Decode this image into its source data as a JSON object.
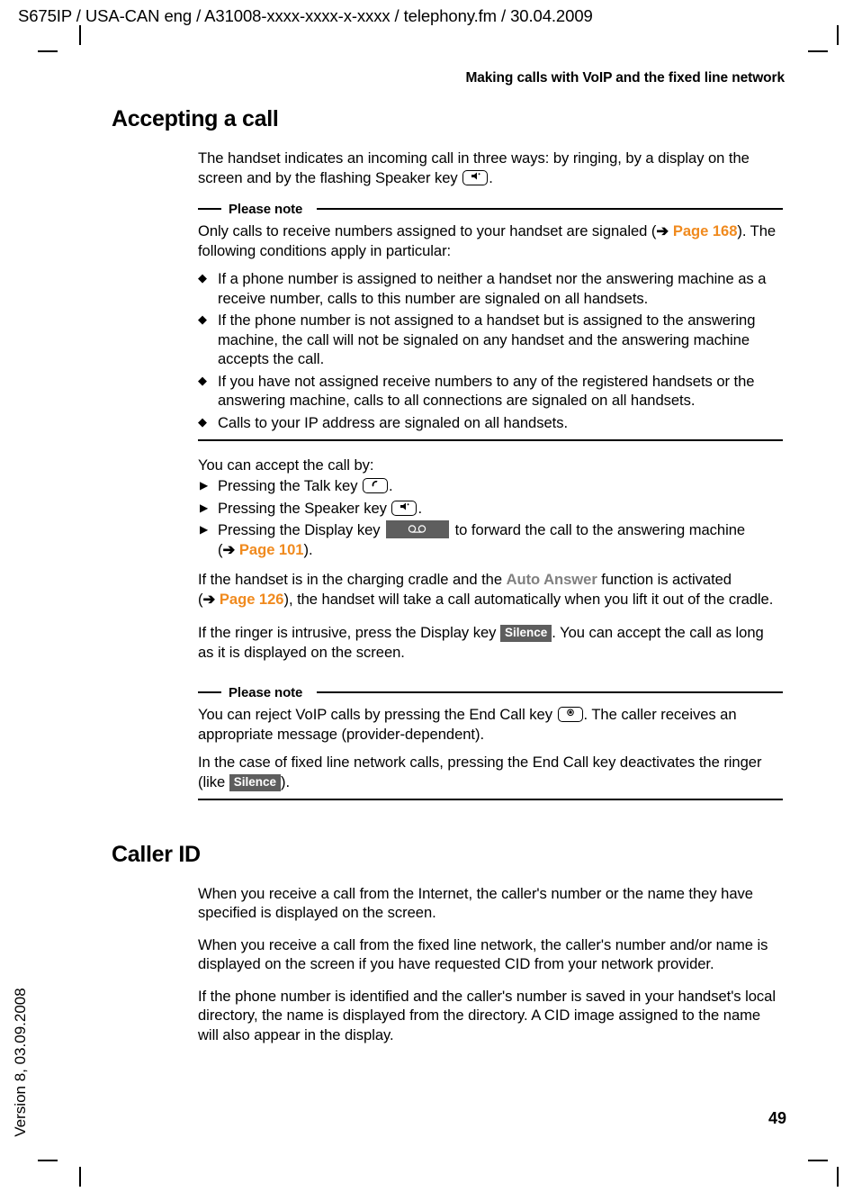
{
  "imposition_line": "S675IP  / USA-CAN eng / A31008-xxxx-xxxx-x-xxxx / telephony.fm / 30.04.2009",
  "version_side": "Version 8, 03.09.2008",
  "running_head": "Making calls with VoIP and the fixed line network",
  "page_number": "49",
  "colors": {
    "xref": "#F08A1E",
    "softkey_bg": "#5E5E5E",
    "uiterm": "#808080"
  },
  "sections": [
    {
      "heading": "Accepting a call",
      "intro": {
        "part1": "The handset indicates an incoming call in three ways: by ringing, by a display on the screen and by the flashing Speaker key ",
        "key_icon": "speaker-key-icon",
        "part2": "."
      },
      "note1": {
        "title": "Please note",
        "lead": {
          "part1": "Only calls to receive numbers assigned to your handset are signaled (",
          "arrow": "➔",
          "link": "Page 168",
          "part2": "). The following conditions apply in particular:"
        },
        "bullets": [
          "If a phone number is assigned to neither a handset nor the answering machine as a receive number, calls to this number are signaled on all handsets.",
          "If the phone number is not assigned to a handset but is assigned to the answering machine, the call will not be signaled on any handset and the answering machine accepts the call.",
          "If you have not assigned receive numbers to any of the registered handsets or the answering machine, calls to all connections are signaled on all handsets.",
          "Calls to your IP address are signaled on all handsets."
        ]
      },
      "accept_lead": "You can accept the call by:",
      "accept_steps": [
        {
          "part1": "Pressing the Talk key ",
          "key_icon": "talk-key-icon",
          "part2": "."
        },
        {
          "part1": "Pressing the Speaker key ",
          "key_icon": "speaker-key-icon",
          "part2": "."
        },
        {
          "part1": "Pressing the Display key ",
          "softkey_icon": "answering-machine-softkey",
          "part2": " to forward the call to the answering machine (",
          "arrow": "➔",
          "link": "Page 101",
          "part3": ")."
        }
      ],
      "auto_answer": {
        "part1": "If the handset is in the charging cradle and the ",
        "term": "Auto Answer",
        "part2": " function is activated (",
        "arrow": "➔",
        "link": "Page 126",
        "part3": "), the handset will take a call automatically when you lift it out of the cradle."
      },
      "silence_para": {
        "part1": "If the ringer is intrusive, press the Display key ",
        "softkey": "Silence",
        "part2": ". You can accept the call as long as it is displayed on the screen."
      },
      "note2": {
        "title": "Please note",
        "para1": {
          "part1": "You can reject VoIP calls by pressing the End Call key ",
          "key_icon": "end-call-key-icon",
          "part2": ". The caller receives an appropriate message (provider-dependent)."
        },
        "para2": {
          "part1": "In the case of fixed line network calls, pressing the End Call key deactivates the ringer (like ",
          "softkey": "Silence",
          "part2": ")."
        }
      }
    },
    {
      "heading": "Caller ID",
      "paragraphs": [
        "When you receive a call from the Internet, the caller's number or the name they have specified is displayed on the screen.",
        "When you receive a call from the fixed line network, the caller's number and/or name is displayed on the screen if you have requested CID from your network provider.",
        "If the phone number is identified and the caller's number is saved in your handset's local directory, the name is displayed from the directory. A CID image assigned to the name will also appear in the display."
      ]
    }
  ]
}
